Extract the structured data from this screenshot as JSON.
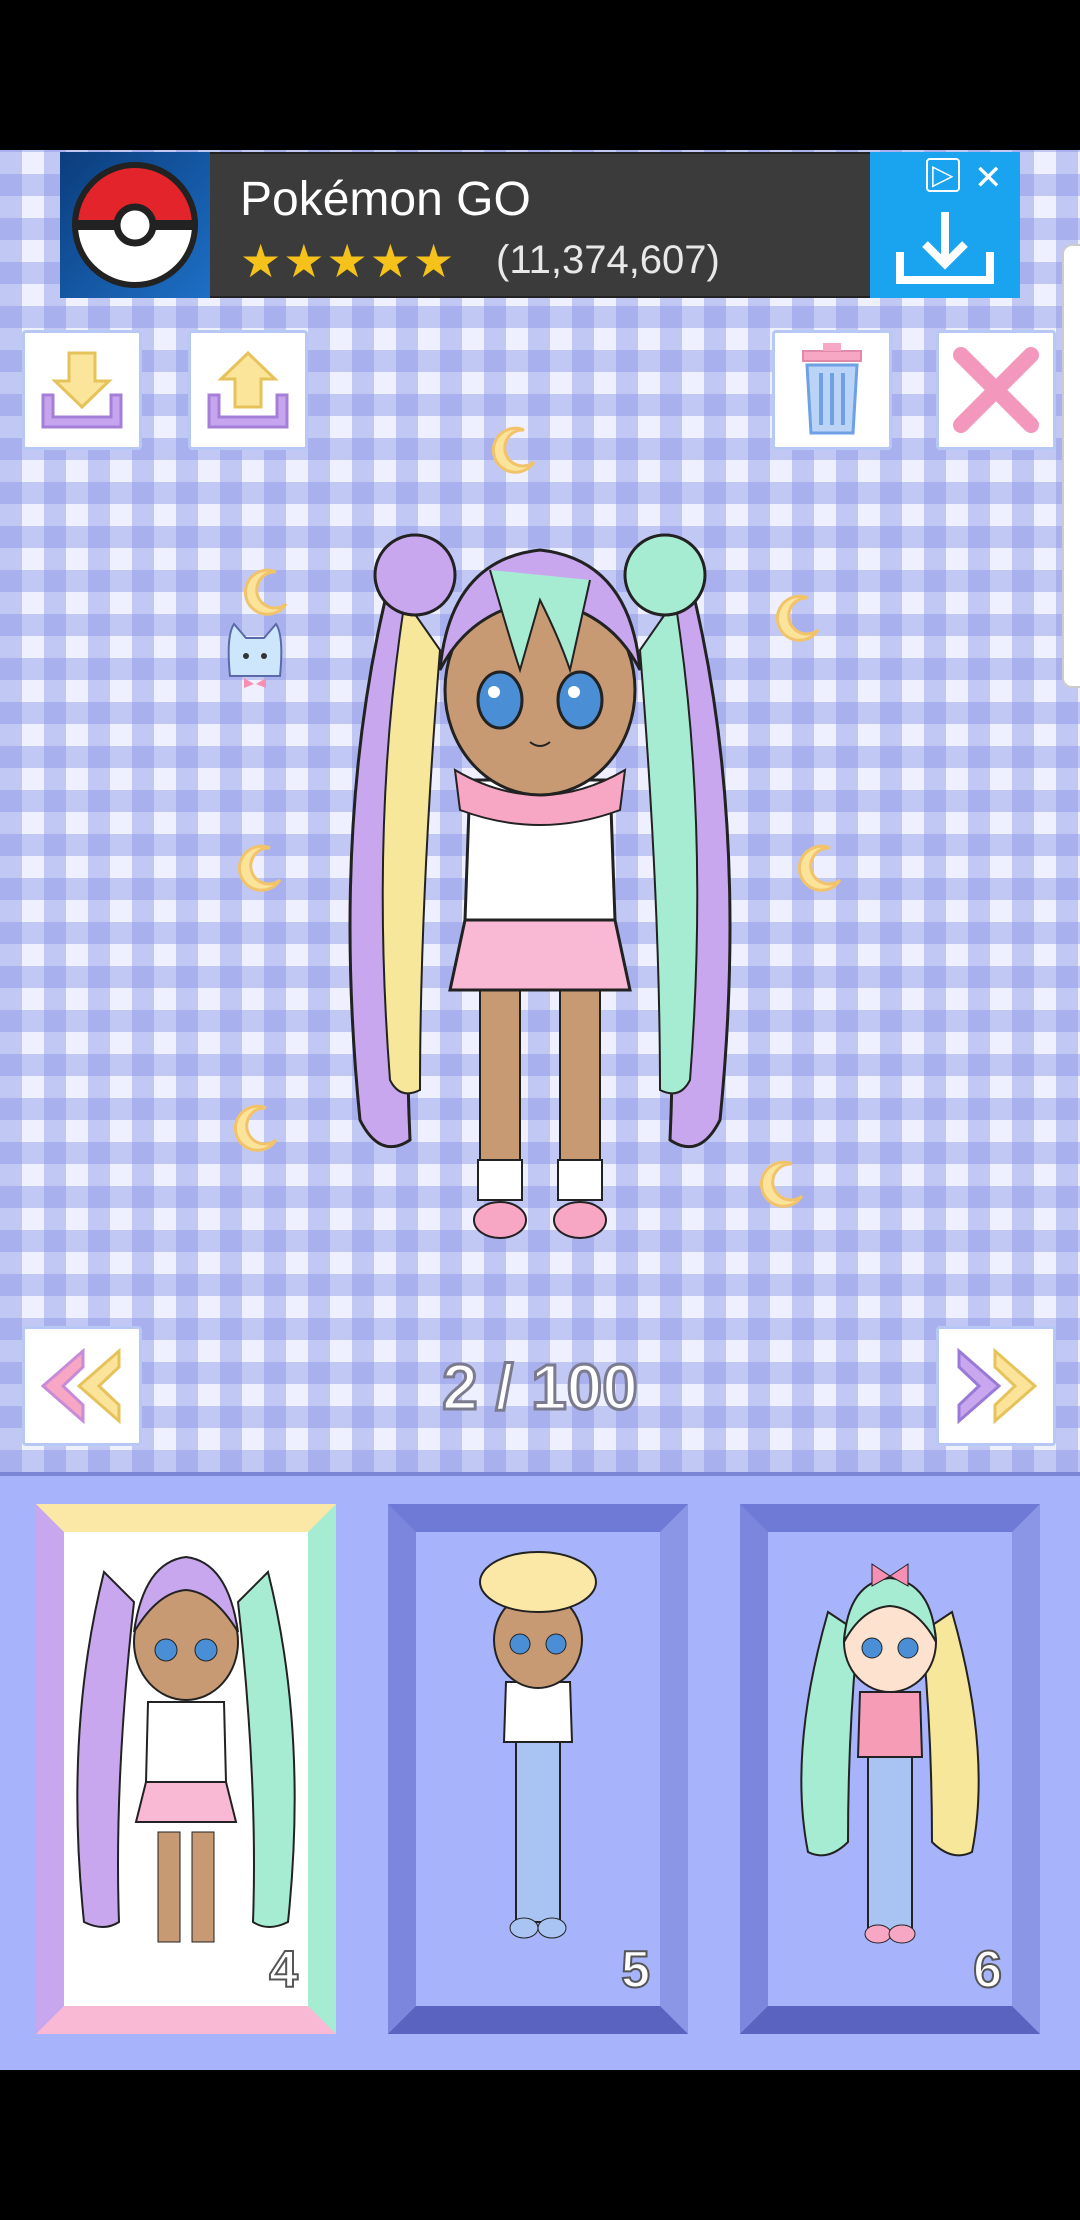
{
  "ad": {
    "title": "Pokémon GO",
    "stars": "★★★★★",
    "rating": "(11,374,607)",
    "close": "✕",
    "adchoices": "▷"
  },
  "toolbar": {
    "save_icon": "download-tray-icon",
    "load_icon": "upload-tray-icon",
    "delete_icon": "trash-icon",
    "close_icon": "close-x-icon"
  },
  "pager": {
    "indicator": "2 / 100"
  },
  "slots": [
    {
      "number": "4",
      "selected": true
    },
    {
      "number": "5",
      "selected": false
    },
    {
      "number": "6",
      "selected": false
    }
  ],
  "colors": {
    "gingham": "#8490e6",
    "panel": "#a7b3fa",
    "ad_blue": "#1aa3ef",
    "star": "#f4c21a"
  }
}
